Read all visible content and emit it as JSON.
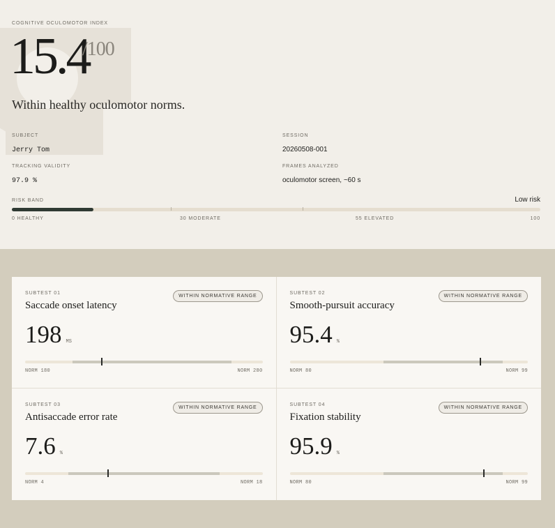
{
  "index": {
    "label": "Cognitive Oculomotor Index",
    "score": "15.4",
    "max": "/100",
    "verdict": "Within healthy oculomotor norms."
  },
  "meta": {
    "subject": {
      "label": "Subject",
      "value": "Jerry Tom"
    },
    "session": {
      "label": "Session",
      "value": "20260508-001"
    },
    "validity": {
      "label": "Tracking Validity",
      "value": "97.9 %"
    },
    "frames": {
      "label": "Frames Analyzed",
      "value": "oculomotor screen, ~60 s"
    }
  },
  "risk_band": {
    "label": "Risk Band",
    "risk": "Low risk",
    "level": 15.4,
    "scale": [
      "0 Healthy",
      "30 Moderate",
      "55 Elevated",
      "100"
    ]
  },
  "subtests": [
    {
      "eyebrow": "Subtest 01",
      "title": "Saccade onset latency",
      "badge": "Within normative range",
      "value": "198",
      "unit": "MS",
      "norm_lo": "NORM 180",
      "norm_hi": "NORM 280",
      "range": [
        150,
        300
      ],
      "norm": [
        180,
        280
      ],
      "current": 198
    },
    {
      "eyebrow": "Subtest 02",
      "title": "Smooth-pursuit accuracy",
      "badge": "Within normative range",
      "value": "95.4",
      "unit": "%",
      "norm_lo": "NORM 80",
      "norm_hi": "NORM 99",
      "range": [
        65,
        103
      ],
      "norm": [
        80,
        99
      ],
      "current": 95.4
    },
    {
      "eyebrow": "Subtest 03",
      "title": "Antisaccade error rate",
      "badge": "Within normative range",
      "value": "7.6",
      "unit": "%",
      "norm_lo": "NORM 4",
      "norm_hi": "NORM 18",
      "range": [
        0,
        22
      ],
      "norm": [
        4,
        18
      ],
      "current": 7.6
    },
    {
      "eyebrow": "Subtest 04",
      "title": "Fixation stability",
      "badge": "Within normative range",
      "value": "95.9",
      "unit": "%",
      "norm_lo": "NORM 80",
      "norm_hi": "NORM 99",
      "range": [
        65,
        103
      ],
      "norm": [
        80,
        99
      ],
      "current": 95.9
    }
  ],
  "colors": {
    "accent": "#2f3a33",
    "hero_bg": "#f2efe9",
    "panel_bg": "#d3cdbd",
    "card_bg": "#f9f7f3"
  }
}
